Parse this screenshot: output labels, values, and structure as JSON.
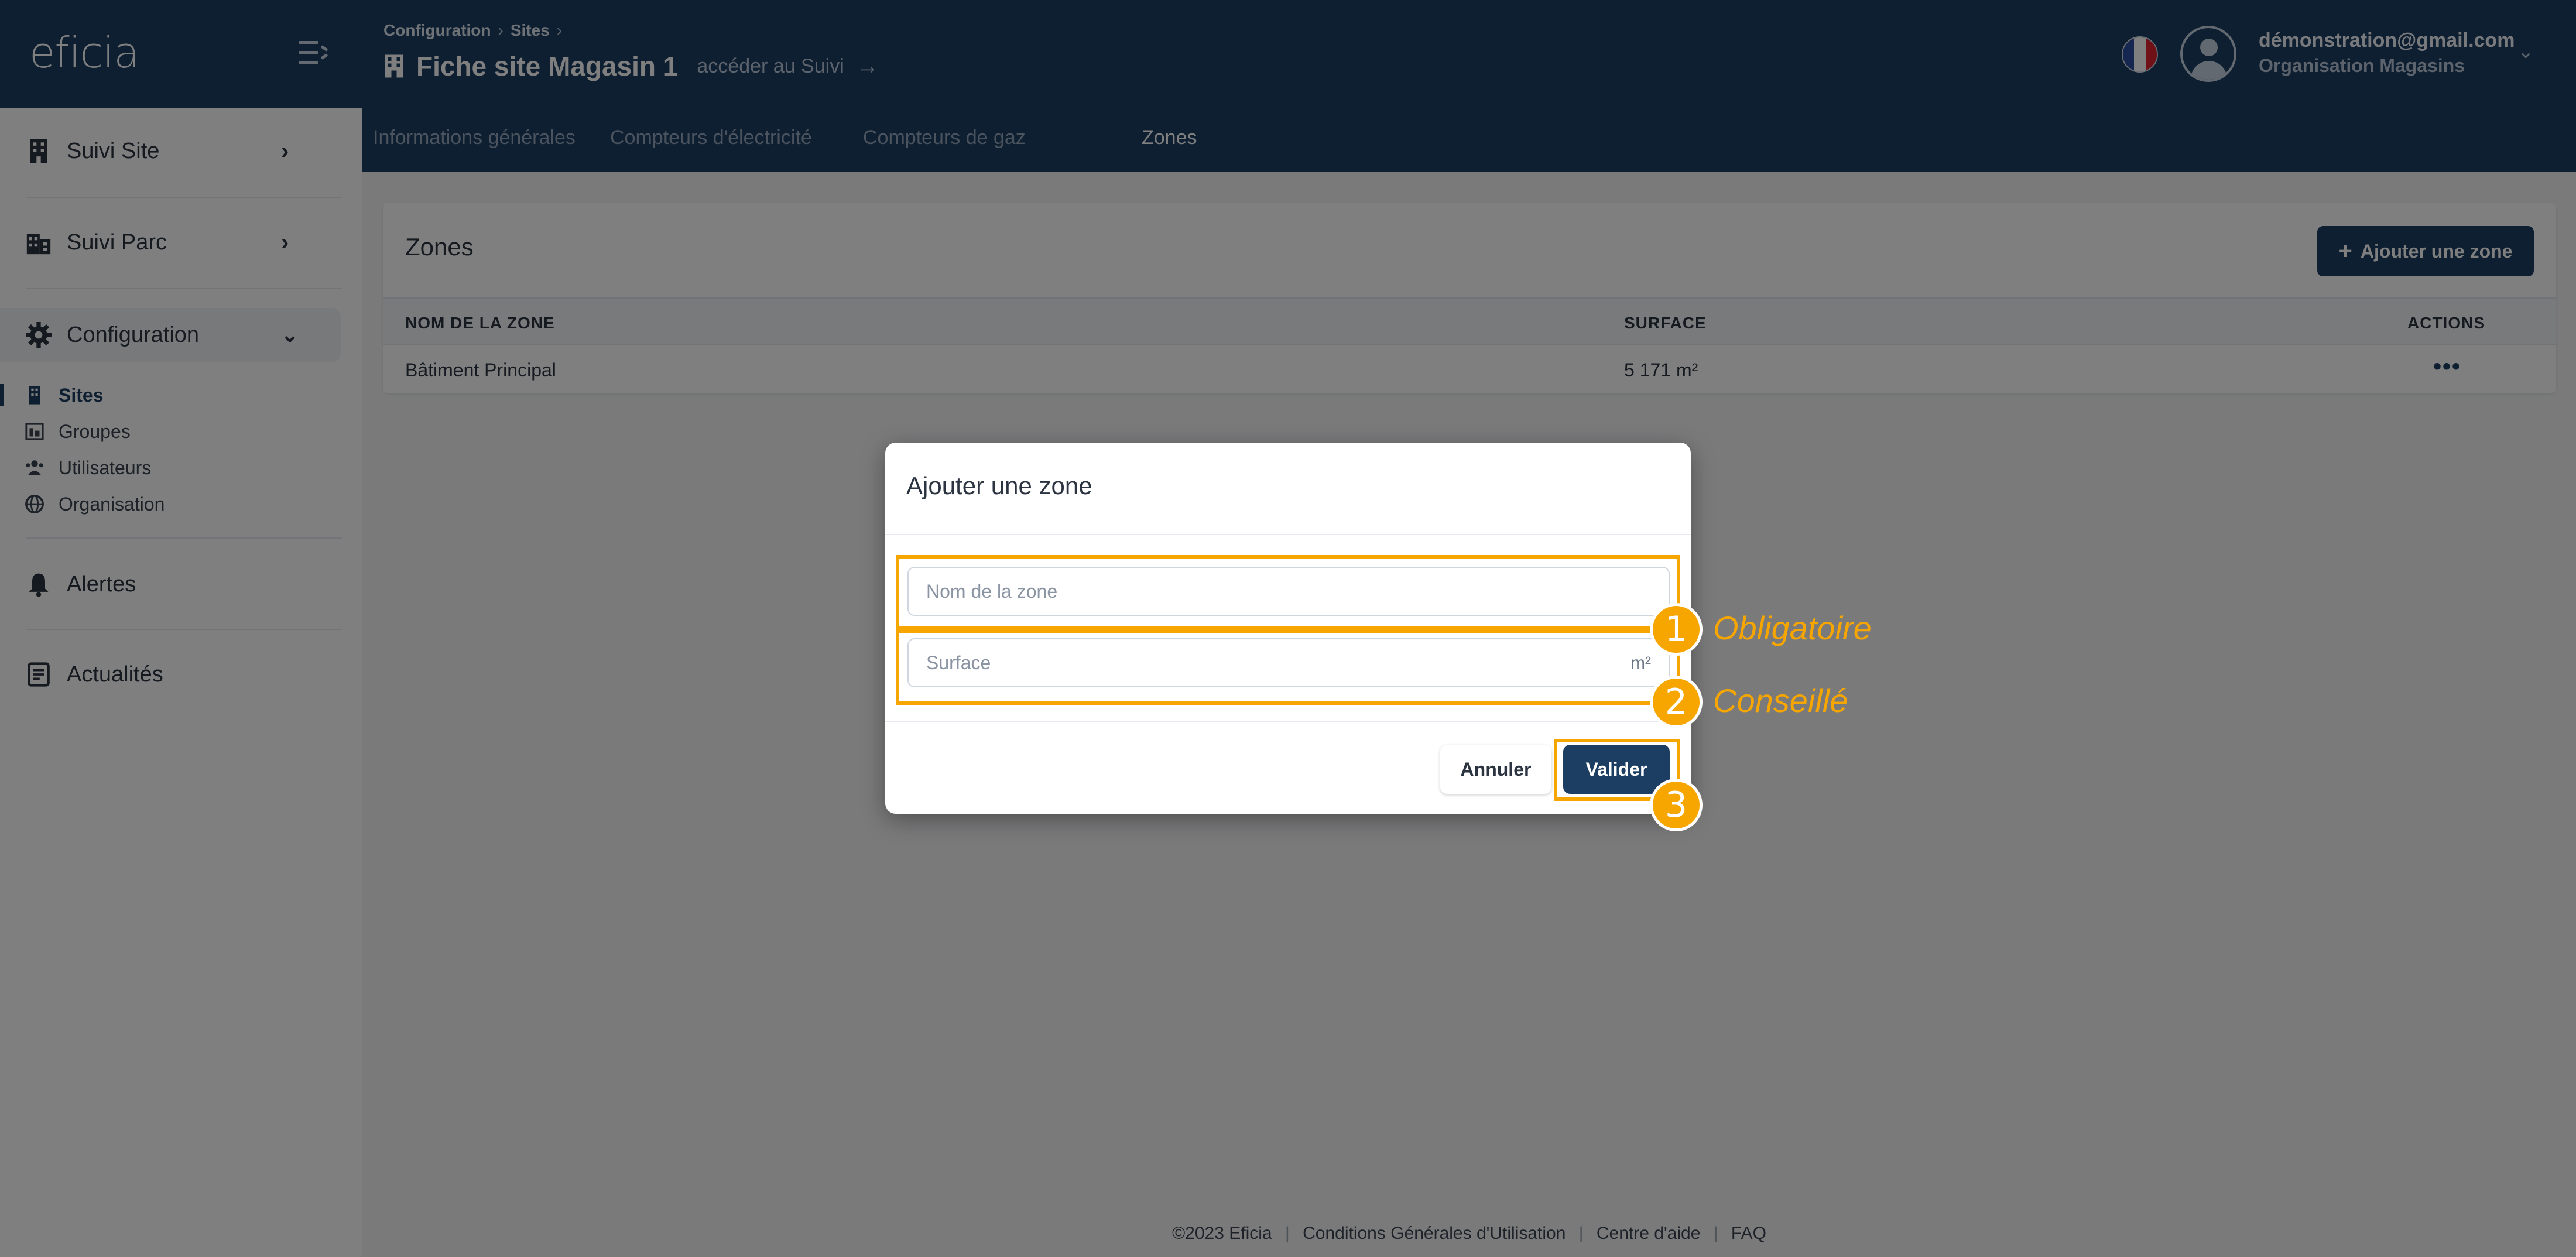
{
  "app": {
    "logo": "eficia",
    "breadcrumb": [
      "Configuration",
      "Sites"
    ],
    "site_title": "Fiche site Magasin 1",
    "site_link": "accéder au Suivi",
    "user_email": "démonstration@gmail.com",
    "user_org": "Organisation Magasins"
  },
  "tabs": [
    {
      "label": "Informations générales"
    },
    {
      "label": "Compteurs d'électricité"
    },
    {
      "label": "Compteurs de gaz"
    },
    {
      "label": "Zones"
    }
  ],
  "sidebar": {
    "items": [
      {
        "label": "Suivi Site"
      },
      {
        "label": "Suivi Parc"
      },
      {
        "label": "Configuration"
      }
    ],
    "sub_items": [
      {
        "label": "Sites"
      },
      {
        "label": "Groupes"
      },
      {
        "label": "Utilisateurs"
      },
      {
        "label": "Organisation"
      }
    ],
    "bottom_items": [
      {
        "label": "Alertes"
      },
      {
        "label": "Actualités"
      }
    ]
  },
  "zones_card": {
    "title": "Zones",
    "add_button": "Ajouter une zone",
    "columns": [
      "NOM DE LA ZONE",
      "SURFACE",
      "ACTIONS"
    ],
    "rows": [
      {
        "name": "Bâtiment Principal",
        "surface": "5 171 m²",
        "actions": "•••"
      }
    ]
  },
  "footer": {
    "copyright": "©2023 Eficia",
    "links": [
      "Conditions Générales d'Utilisation",
      "Centre d'aide",
      "FAQ"
    ]
  },
  "modal": {
    "title": "Ajouter une zone",
    "name_placeholder": "Nom de la zone",
    "surface_placeholder": "Surface",
    "surface_unit": "m²",
    "cancel": "Annuler",
    "submit": "Valider"
  },
  "annotations": [
    {
      "number": "1",
      "label": "Obligatoire"
    },
    {
      "number": "2",
      "label": "Conseillé"
    },
    {
      "number": "3",
      "label": ""
    }
  ],
  "colors": {
    "primary": "#1d3e63",
    "highlight": "#f7a600"
  }
}
